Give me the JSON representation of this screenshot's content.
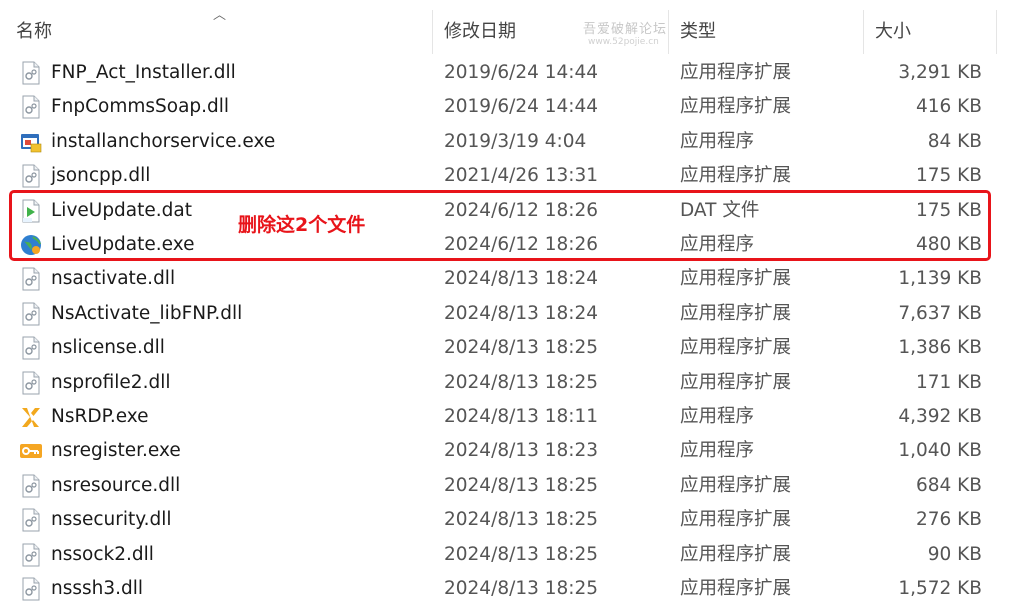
{
  "headers": {
    "name": "名称",
    "date": "修改日期",
    "type": "类型",
    "size": "大小"
  },
  "watermark": {
    "line1": "吾爱破解论坛",
    "line2": "www.52pojie.cn"
  },
  "annotation": "删除这2个文件",
  "colors": {
    "highlight": "#e8141a"
  },
  "files": [
    {
      "name": "FNP_Act_Installer.dll",
      "date": "2019/6/24 14:44",
      "type": "应用程序扩展",
      "size": "3,291 KB",
      "icon": "dll-file-icon"
    },
    {
      "name": "FnpCommsSoap.dll",
      "date": "2019/6/24 14:44",
      "type": "应用程序扩展",
      "size": "416 KB",
      "icon": "dll-file-icon"
    },
    {
      "name": "installanchorservice.exe",
      "date": "2019/3/19 4:04",
      "type": "应用程序",
      "size": "84 KB",
      "icon": "installer-exe-icon"
    },
    {
      "name": "jsoncpp.dll",
      "date": "2021/4/26 13:31",
      "type": "应用程序扩展",
      "size": "175 KB",
      "icon": "dll-file-icon"
    },
    {
      "name": "LiveUpdate.dat",
      "date": "2024/6/12 18:26",
      "type": "DAT 文件",
      "size": "175 KB",
      "icon": "dat-file-icon"
    },
    {
      "name": "LiveUpdate.exe",
      "date": "2024/6/12 18:26",
      "type": "应用程序",
      "size": "480 KB",
      "icon": "globe-exe-icon"
    },
    {
      "name": "nsactivate.dll",
      "date": "2024/8/13 18:24",
      "type": "应用程序扩展",
      "size": "1,139 KB",
      "icon": "dll-file-icon"
    },
    {
      "name": "NsActivate_libFNP.dll",
      "date": "2024/8/13 18:24",
      "type": "应用程序扩展",
      "size": "7,637 KB",
      "icon": "dll-file-icon"
    },
    {
      "name": "nslicense.dll",
      "date": "2024/8/13 18:25",
      "type": "应用程序扩展",
      "size": "1,386 KB",
      "icon": "dll-file-icon"
    },
    {
      "name": "nsprofile2.dll",
      "date": "2024/8/13 18:25",
      "type": "应用程序扩展",
      "size": "171 KB",
      "icon": "dll-file-icon"
    },
    {
      "name": "NsRDP.exe",
      "date": "2024/8/13 18:11",
      "type": "应用程序",
      "size": "4,392 KB",
      "icon": "xmanager-x-icon"
    },
    {
      "name": "nsregister.exe",
      "date": "2024/8/13 18:23",
      "type": "应用程序",
      "size": "1,040 KB",
      "icon": "key-exe-icon"
    },
    {
      "name": "nsresource.dll",
      "date": "2024/8/13 18:25",
      "type": "应用程序扩展",
      "size": "684 KB",
      "icon": "dll-file-icon"
    },
    {
      "name": "nssecurity.dll",
      "date": "2024/8/13 18:25",
      "type": "应用程序扩展",
      "size": "276 KB",
      "icon": "dll-file-icon"
    },
    {
      "name": "nssock2.dll",
      "date": "2024/8/13 18:25",
      "type": "应用程序扩展",
      "size": "90 KB",
      "icon": "dll-file-icon"
    },
    {
      "name": "nsssh3.dll",
      "date": "2024/8/13 18:25",
      "type": "应用程序扩展",
      "size": "1,572 KB",
      "icon": "dll-file-icon"
    }
  ]
}
